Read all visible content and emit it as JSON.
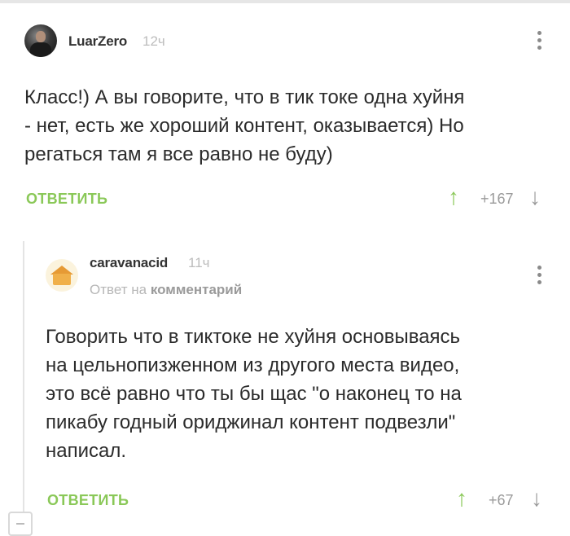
{
  "comments": [
    {
      "username": "LuarZero",
      "time": "12ч",
      "text_lines": [
        "Класс!) А вы говорите, что в тик токе одна хуйня",
        "- нет, есть же хороший контент, оказывается) Но",
        "регаться там я все равно не буду)"
      ],
      "reply_label": "ОТВЕТИТЬ",
      "score": "+167"
    },
    {
      "username": "caravanacid",
      "time": "11ч",
      "reply_to_prefix": "Ответ на",
      "reply_to_link": "комментарий",
      "text_lines": [
        "Говорить что в тиктоке не хуйня основываясь",
        "на цельнопизженном из другого места видео,",
        "это всё равно что ты бы щас \"о наконец то на",
        "пикабу годный ориджинал контент подвезли\"",
        "написал."
      ],
      "reply_label": "ОТВЕТИТЬ",
      "score": "+67"
    }
  ],
  "icons": {
    "upvote": "arrow-up-icon",
    "downvote": "arrow-down-icon",
    "more": "kebab-menu-icon",
    "collapse": "collapse-thread-icon"
  },
  "colors": {
    "accent_green": "#8ac858",
    "muted_gray": "#9a9a9a"
  }
}
